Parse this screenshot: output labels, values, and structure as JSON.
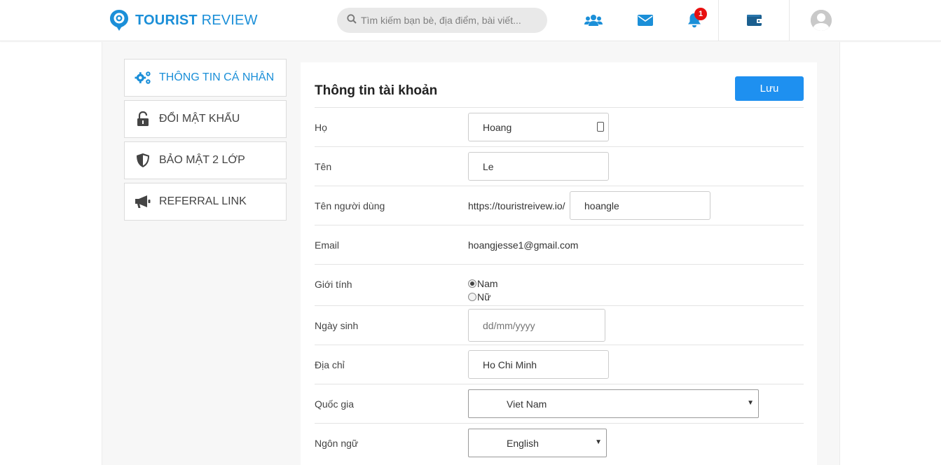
{
  "header": {
    "logo": {
      "bold": "TOURIST",
      "light": "REVIEW"
    },
    "search_placeholder": "Tìm kiếm bạn bè, địa điểm, bài viết...",
    "notification_count": "1",
    "icons": [
      "users-icon",
      "envelope-icon",
      "bell-icon",
      "wallet-icon",
      "avatar-icon"
    ],
    "accent": "#1b8fd8"
  },
  "sidebar": {
    "items": [
      {
        "label": "THÔNG TIN CÁ NHÂN",
        "icon": "cogs-icon",
        "active": true
      },
      {
        "label": "ĐỔI MẬT KHẨU",
        "icon": "unlock-icon",
        "active": false
      },
      {
        "label": "BẢO MẬT 2 LỚP",
        "icon": "shield-icon",
        "active": false
      },
      {
        "label": "REFERRAL LINK",
        "icon": "megaphone-icon",
        "active": false
      }
    ]
  },
  "form": {
    "title": "Thông tin tài khoản",
    "save_label": "Lưu",
    "save_color": "#1e90f0",
    "fields": {
      "last_name": {
        "label": "Họ",
        "value": "Hoang"
      },
      "first_name": {
        "label": "Tên",
        "value": "Le"
      },
      "username": {
        "label": "Tên người dùng",
        "prefix": "https://touristreivew.io/",
        "value": "hoangle"
      },
      "email": {
        "label": "Email",
        "value": "hoangjesse1@gmail.com"
      },
      "gender": {
        "label": "Giới tính",
        "options": [
          "Nam",
          "Nữ"
        ],
        "selected": "Nam"
      },
      "birthday": {
        "label": "Ngày sinh",
        "placeholder": "dd/mm/yyyy"
      },
      "address": {
        "label": "Địa chỉ",
        "value": "Ho Chi Minh"
      },
      "country": {
        "label": "Quốc gia",
        "value": "Viet Nam"
      },
      "language": {
        "label": "Ngôn ngữ",
        "value": "English"
      }
    }
  }
}
